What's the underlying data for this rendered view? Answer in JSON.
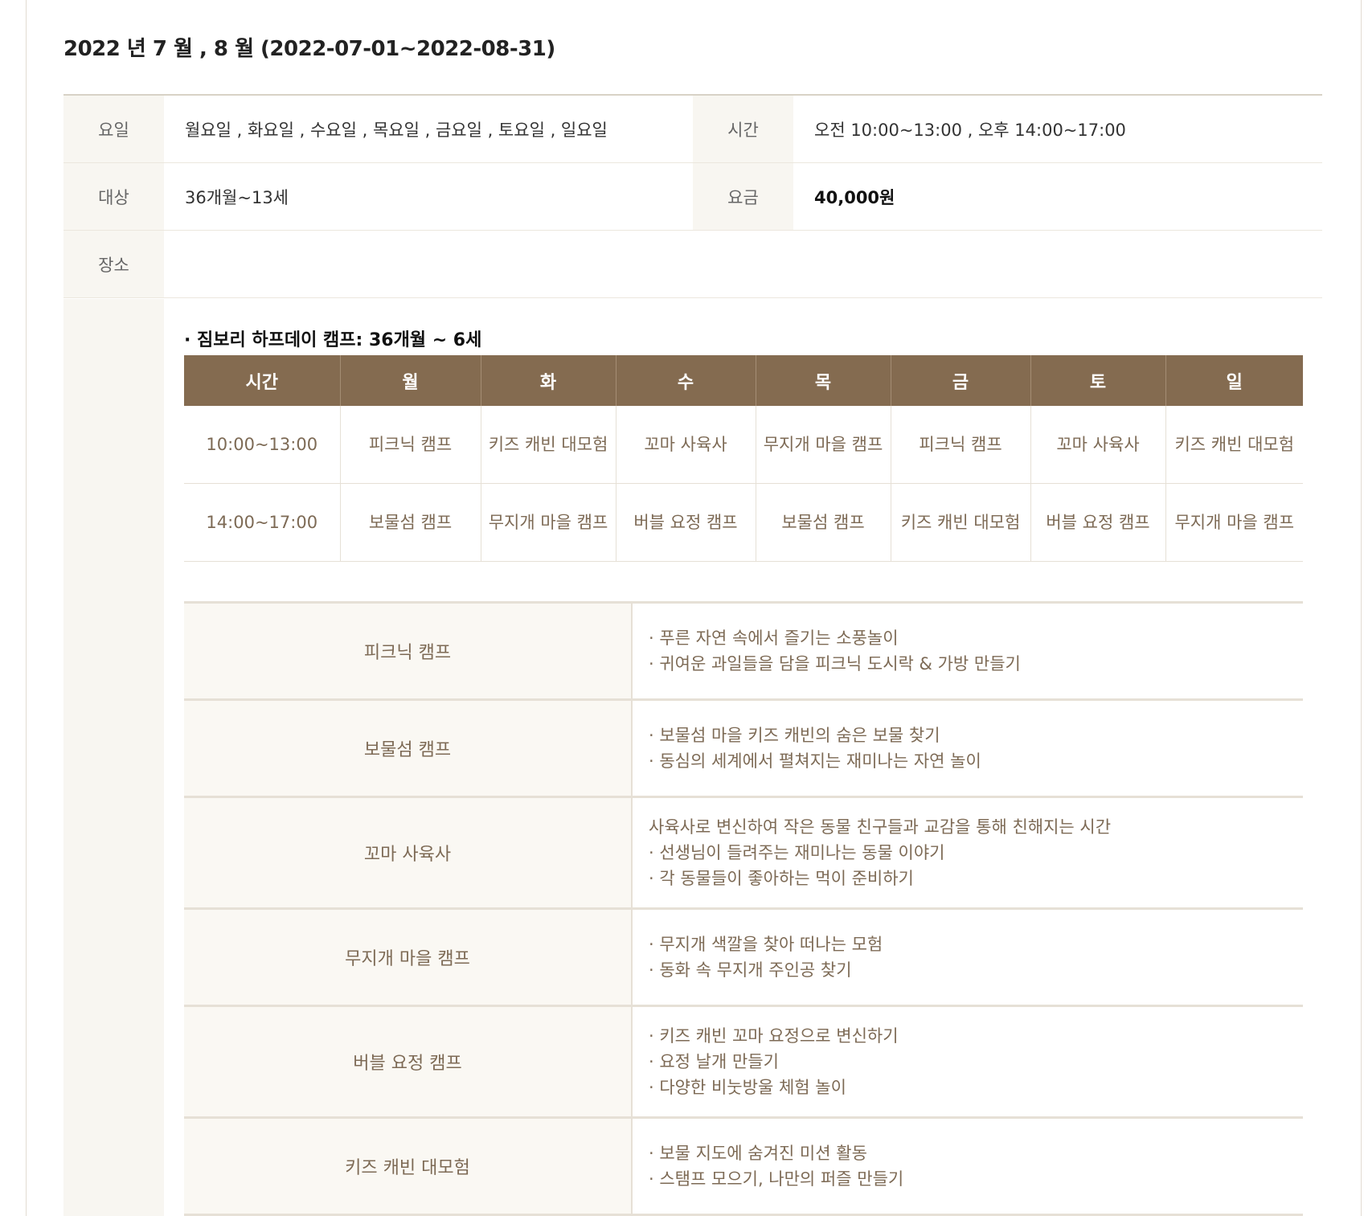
{
  "period": "2022 년 7 월 , 8 월 (2022-07-01~2022-08-31)",
  "info": {
    "day_label": "요일",
    "day_value": "월요일 , 화요일 , 수요일 , 목요일 , 금요일 , 토요일 , 일요일",
    "time_label": "시간",
    "time_value": "오전 10:00~13:00 , 오후 14:00~17:00",
    "target_label": "대상",
    "target_value": "36개월~13세",
    "fee_label": "요금",
    "fee_value": "40,000원",
    "place_label": "장소",
    "place_value": ""
  },
  "schedule": {
    "title": "· 짐보리 하프데이 캠프: 36개월 ~ 6세",
    "headers": [
      "시간",
      "월",
      "화",
      "수",
      "목",
      "금",
      "토",
      "일"
    ],
    "rows": [
      [
        "10:00~13:00",
        "피크닉 캠프",
        "키즈 캐빈 대모험",
        "꼬마 사육사",
        "무지개 마을 캠프",
        "피크닉 캠프",
        "꼬마 사육사",
        "키즈 캐빈 대모험"
      ],
      [
        "14:00~17:00",
        "보물섬 캠프",
        "무지개 마을 캠프",
        "버블 요정 캠프",
        "보물섬 캠프",
        "키즈 캐빈 대모험",
        "버블 요정 캠프",
        "무지개 마을 캠프"
      ]
    ]
  },
  "programs": [
    {
      "name": "피크닉 캠프",
      "lines": [
        "· 푸른 자연 속에서 즐기는 소풍놀이",
        "· 귀여운 과일들을 담을 피크닉 도시락 & 가방 만들기"
      ]
    },
    {
      "name": "보물섬 캠프",
      "lines": [
        "· 보물섬 마을 키즈 캐빈의 숨은 보물 찾기",
        "· 동심의 세계에서 펼쳐지는 재미나는 자연 놀이"
      ]
    },
    {
      "name": "꼬마 사육사",
      "lines": [
        "사육사로 변신하여 작은 동물 친구들과 교감을 통해 친해지는 시간",
        "· 선생님이 들려주는 재미나는 동물 이야기",
        "· 각 동물들이 좋아하는 먹이 준비하기"
      ]
    },
    {
      "name": "무지개 마을 캠프",
      "lines": [
        "· 무지개 색깔을 찾아 떠나는 모험",
        "· 동화 속 무지개 주인공 찾기"
      ]
    },
    {
      "name": "버블 요정 캠프",
      "lines": [
        "· 키즈 캐빈 꼬마 요정으로 변신하기",
        "· 요정 날개 만들기",
        "· 다양한 비눗방울 체험 놀이"
      ]
    },
    {
      "name": "키즈 캐빈 대모험",
      "lines": [
        "· 보물 지도에 숨겨진 미션 활동",
        "· 스탬프 모으기, 나만의 퍼즐 만들기"
      ]
    }
  ]
}
